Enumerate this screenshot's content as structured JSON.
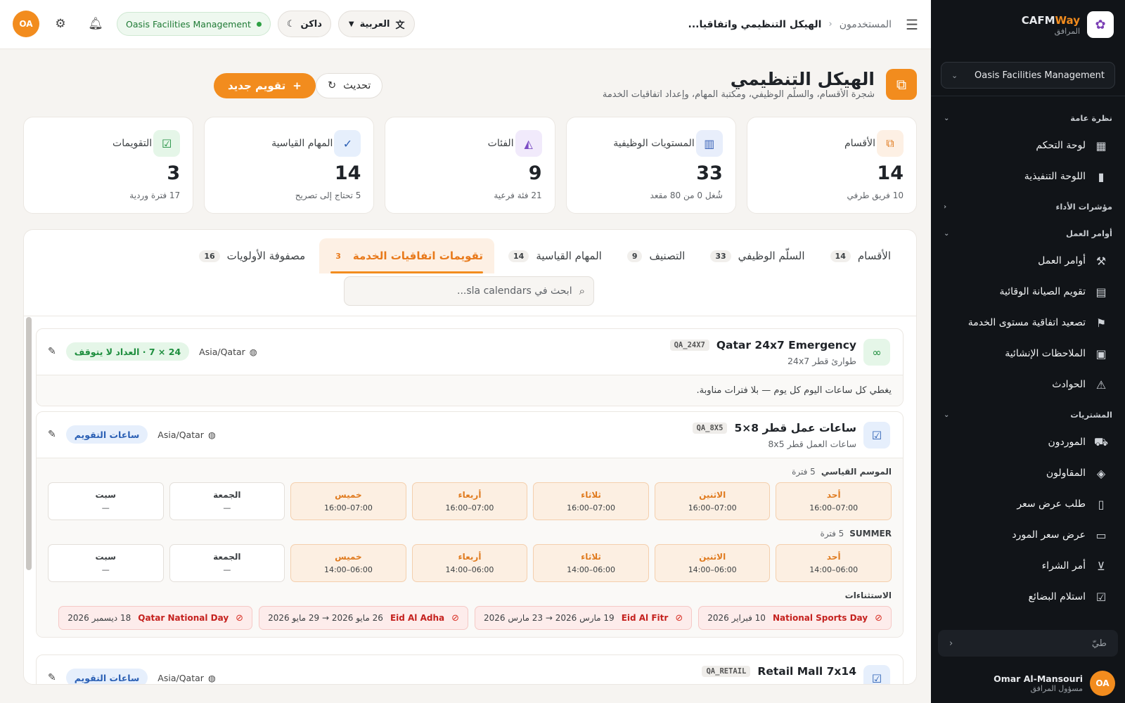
{
  "sidebar": {
    "brand_name_a": "CAFM",
    "brand_name_b": "Way",
    "brand_sub": "المرافق",
    "org": "Oasis Facilities Management",
    "sections": {
      "overview": "نظرة عامة",
      "kpi": "مؤشرات الأداء",
      "work_orders": "أوامر العمل",
      "purchasing": "المشتريات"
    },
    "items": {
      "dashboard": "لوحة التحكم",
      "executive": "اللوحة التنفيذية",
      "work_orders": "أوامر العمل",
      "ppm_calendar": "تقويم الصيانة الوقائية",
      "sla_escalation": "تصعيد اتفاقية مستوى الخدمة",
      "construction_notes": "الملاحظات الإنشائية",
      "incidents": "الحوادث",
      "suppliers": "الموردون",
      "contractors": "المقاولون",
      "rfq": "طلب عرض سعر",
      "supplier_quote": "عرض سعر المورد",
      "purchase_order": "أمر الشراء",
      "goods_receipt": "استلام البضائع"
    },
    "collapse_label": "طيّ",
    "user_name": "Omar Al-Mansouri",
    "user_role": "مسؤول المرافق",
    "user_initials": "OA"
  },
  "topbar": {
    "crumb_parent": "المستخدمون",
    "crumb_current": "الهيكل التنظيمي واتفاقيا...",
    "language": "العربية",
    "theme": "داكن",
    "org": "Oasis Facilities Management",
    "avatar": "OA"
  },
  "page": {
    "title": "الهيكل التنظيمي",
    "subtitle": "شجرة الأقسام، والسلّم الوظيفي، ومكتبة المهام، وإعداد اتفاقيات الخدمة",
    "new_button": "تقويم جديد",
    "refresh_button": "تحديث"
  },
  "stats": [
    {
      "label": "الأقسام",
      "value": "14",
      "sub": "10 فريق طرفي"
    },
    {
      "label": "المستويات الوظيفية",
      "value": "33",
      "sub": "شُغل 0 من 80 مقعد"
    },
    {
      "label": "الفئات",
      "value": "9",
      "sub": "21 فئة فرعية"
    },
    {
      "label": "المهام القياسية",
      "value": "14",
      "sub": "5 تحتاج إلى تصريح"
    },
    {
      "label": "التقويمات",
      "value": "3",
      "sub": "17 فترة وردية"
    }
  ],
  "tabs": [
    {
      "label": "الأقسام",
      "count": "14"
    },
    {
      "label": "السلّم الوظيفي",
      "count": "33"
    },
    {
      "label": "التصنيف",
      "count": "9"
    },
    {
      "label": "المهام القياسية",
      "count": "14"
    },
    {
      "label": "تقويمات اتفاقيات الخدمة",
      "count": "3"
    },
    {
      "label": "مصفوفة الأولويات",
      "count": "16"
    }
  ],
  "search": {
    "placeholder": "ابحث في sla calendars..."
  },
  "calendars": [
    {
      "name": "Qatar 24x7 Emergency",
      "code": "QA_24X7",
      "sub": "طوارئ قطر 24x7",
      "tz": "Asia/Qatar",
      "badge": "24 × 7 · العداد لا يتوقف",
      "note": "يغطي كل ساعات اليوم كل يوم — بلا فترات مناوبة."
    },
    {
      "name": "ساعات عمل قطر 8×5",
      "code": "QA_8X5",
      "sub": "ساعات العمل قطر 8x5",
      "tz": "Asia/Qatar",
      "badge": "ساعات التقويم",
      "seasons": [
        {
          "name": "الموسم القياسي",
          "count": "5 فترة"
        },
        {
          "name": "SUMMER",
          "count": "5 فترة"
        }
      ],
      "days": [
        "أحد",
        "الاثنين",
        "ثلاثاء",
        "أربعاء",
        "خميس",
        "الجمعة",
        "سبت"
      ],
      "standard_times": [
        "16:00–07:00",
        "16:00–07:00",
        "16:00–07:00",
        "16:00–07:00",
        "16:00–07:00",
        "—",
        "—"
      ],
      "summer_times": [
        "14:00–06:00",
        "14:00–06:00",
        "14:00–06:00",
        "14:00–06:00",
        "14:00–06:00",
        "—",
        "—"
      ],
      "exceptions_label": "الاستثناءات",
      "exceptions": [
        {
          "name": "National Sports Day",
          "date": "10 فبراير 2026"
        },
        {
          "name": "Eid Al Fitr",
          "date": "19 مارس 2026 → 23 مارس 2026"
        },
        {
          "name": "Eid Al Adha",
          "date": "26 مايو 2026 → 29 مايو 2026"
        },
        {
          "name": "Qatar National Day",
          "date": "18 ديسمبر 2026"
        }
      ]
    },
    {
      "name": "Retail Mall 7x14",
      "code": "QA_RETAIL",
      "tz": "Asia/Qatar",
      "badge": "ساعات التقويم"
    }
  ],
  "colors": {
    "accent": "#f28c1e",
    "sidebar": "#111418",
    "success": "#2ea043"
  }
}
